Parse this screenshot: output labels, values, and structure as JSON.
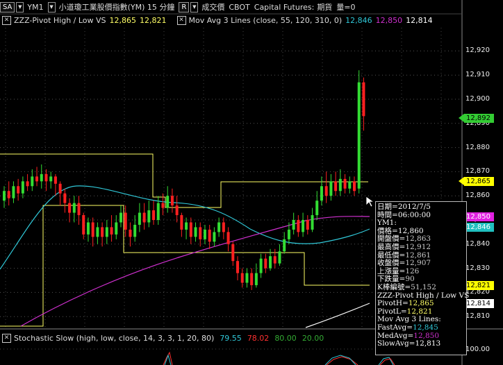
{
  "toolbar": {
    "symbol_box": "SA",
    "symbol": "YM1",
    "product": "小道瓊工業股價指數(YM) 15 分鐘",
    "mode_box": "R",
    "price_type": "成交價",
    "exchange": "CBOT",
    "broker": "Capital Futures:",
    "category": "期貨",
    "volume_label": "量=0"
  },
  "legend": {
    "pivot_name": "ZZZ-Pivot High / Low VS",
    "pivot_high": "12,865",
    "pivot_low": "12,821",
    "ma_name": "Mov Avg 3 Lines  (close, 55, 120, 310, 0)",
    "ma_fast": "12,846",
    "ma_med": "12,850",
    "ma_slow": "12,814"
  },
  "y_axis": [
    "12,920",
    "12,910",
    "12,900",
    "12,890",
    "12,880",
    "12,870",
    "12,860",
    "12,850",
    "12,840",
    "12,830",
    "12,820",
    "12,810"
  ],
  "price_tags": [
    {
      "value": "12,892",
      "color": "#33cc33",
      "text": "#000"
    },
    {
      "value": "12,865",
      "color": "#ffff00",
      "text": "#000"
    },
    {
      "value": "12,850",
      "color": "#e020e0",
      "text": "#fff"
    },
    {
      "value": "12,846",
      "color": "#20c0c0",
      "text": "#fff"
    },
    {
      "value": "12,821",
      "color": "#ffff00",
      "text": "#000"
    },
    {
      "value": "12,814",
      "color": "#ffffff",
      "text": "#000"
    }
  ],
  "info_box": [
    "日期=2012/7/5",
    "時間=06:00:00",
    "YM1:",
    "價格=12,860",
    "開盤價=12,863",
    "最高價=12,912",
    "最低價=12,861",
    "收盤價=12,907",
    "上漲量=126",
    "下跌量=90",
    "K棒編號=51,152",
    "ZZZ-Pivot High / Low VS",
    "PivotH=12,865",
    "PivotL=12,821",
    "Mov Avg 3 Lines:",
    "FastAvg=12,845",
    "MedAvg=12,850",
    "SlowAvg=12,813"
  ],
  "stochastic": {
    "name": "Stochastic Slow  (high, low, close, 14, 3, 3, 1, 20, 80)",
    "v1": "79.55",
    "v2": "78.02",
    "v3": "80.00",
    "v4": "20.00",
    "axis_top": "100.00"
  },
  "colors": {
    "up": "#33dd33",
    "down": "#ff2020",
    "pivot": "#ffff66",
    "fast": "#30c8d8",
    "med": "#d030d0",
    "slow": "#ffffff",
    "sto_k": "#30c8d8",
    "sto_d": "#ff3030",
    "sto_80": "#33aa33",
    "sto_20": "#33aa33"
  }
}
